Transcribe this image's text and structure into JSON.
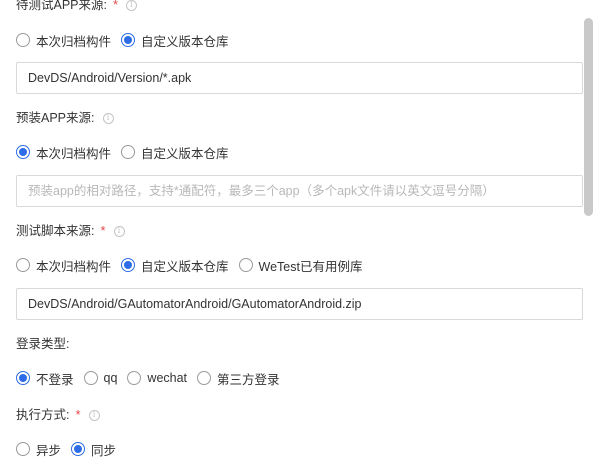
{
  "app_source": {
    "label": "待测试APP来源:",
    "options": [
      "本次归档构件",
      "自定义版本仓库"
    ],
    "selected": 1,
    "input_value": "DevDS/Android/Version/*.apk"
  },
  "preinstall_source": {
    "label": "预装APP来源:",
    "options": [
      "本次归档构件",
      "自定义版本仓库"
    ],
    "selected": 0,
    "input_placeholder": "预装app的相对路径，支持*通配符，最多三个app（多个apk文件请以英文逗号分隔）"
  },
  "script_source": {
    "label": "测试脚本来源:",
    "options": [
      "本次归档构件",
      "自定义版本仓库",
      "WeTest已有用例库"
    ],
    "selected": 1,
    "input_value": "DevDS/Android/GAutomatorAndroid/GAutomatorAndroid.zip"
  },
  "login_type": {
    "label": "登录类型:",
    "options": [
      "不登录",
      "qq",
      "wechat",
      "第三方登录"
    ],
    "selected": 0
  },
  "exec_mode": {
    "label": "执行方式:",
    "options": [
      "异步",
      "同步"
    ],
    "selected": 1
  },
  "required_mark": "*",
  "info_glyph": "i",
  "accent_color": "#2e6de6",
  "required_color": "#e5484d"
}
